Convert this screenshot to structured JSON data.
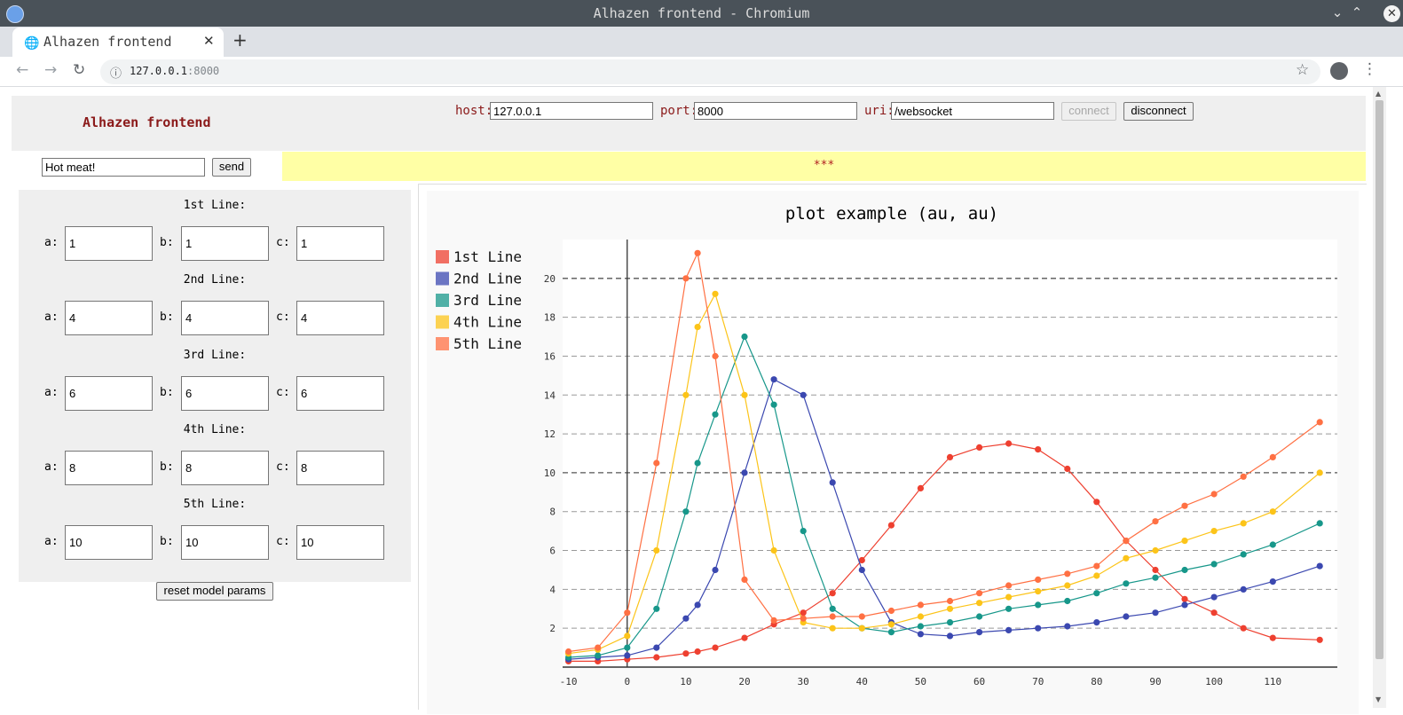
{
  "window": {
    "title": "Alhazen frontend - Chromium"
  },
  "browser": {
    "tab_title": "Alhazen frontend",
    "url_host": "127.0.0.1",
    "url_port": ":8000"
  },
  "header": {
    "brand": "Alhazen frontend",
    "host_label": "host:",
    "host_value": "127.0.0.1",
    "port_label": "port:",
    "port_value": "8000",
    "uri_label": "uri:",
    "uri_value": "/websocket",
    "connect_label": "connect",
    "disconnect_label": "disconnect"
  },
  "message": {
    "value": "Hot meat!",
    "send_label": "send"
  },
  "status": {
    "text": "***"
  },
  "params": {
    "lines": [
      {
        "heading": "1st Line:",
        "a": "1",
        "b": "1",
        "c": "1"
      },
      {
        "heading": "2nd Line:",
        "a": "4",
        "b": "4",
        "c": "4"
      },
      {
        "heading": "3rd Line:",
        "a": "6",
        "b": "6",
        "c": "6"
      },
      {
        "heading": "4th Line:",
        "a": "8",
        "b": "8",
        "c": "8"
      },
      {
        "heading": "5th Line:",
        "a": "10",
        "b": "10",
        "c": "10"
      }
    ],
    "a_label": "a:",
    "b_label": "b:",
    "c_label": "c:",
    "reset_label": "reset model params"
  },
  "chart_data": {
    "type": "line",
    "title": "plot example (au, au)",
    "xlim": [
      -11,
      121
    ],
    "ylim": [
      0,
      22
    ],
    "x_ticks": [
      "-10",
      "0",
      "10",
      "20",
      "30",
      "40",
      "50",
      "60",
      "70",
      "80",
      "90",
      "100",
      "110"
    ],
    "y_ticks": [
      "2",
      "4",
      "6",
      "8",
      "10",
      "12",
      "14",
      "16",
      "18",
      "20"
    ],
    "grid": "horizontal dashed",
    "legend_position": "top-left",
    "x": [
      -10,
      -5,
      0,
      5,
      10,
      12,
      15,
      20,
      25,
      30,
      35,
      40,
      45,
      50,
      55,
      60,
      65,
      70,
      75,
      80,
      85,
      90,
      95,
      100,
      105,
      110,
      118
    ],
    "series": [
      {
        "name": "1st Line",
        "color": "#ee4030",
        "values": [
          0.3,
          0.3,
          0.4,
          0.5,
          0.7,
          0.8,
          1.0,
          1.5,
          2.2,
          2.8,
          3.8,
          5.5,
          7.3,
          9.2,
          10.8,
          11.3,
          11.5,
          11.2,
          10.2,
          8.5,
          6.5,
          5.0,
          3.5,
          2.8,
          2.0,
          1.5,
          1.4
        ]
      },
      {
        "name": "2nd Line",
        "color": "#3b48b0",
        "values": [
          0.4,
          0.5,
          0.6,
          1.0,
          2.5,
          3.2,
          5.0,
          10.0,
          14.8,
          14.0,
          9.5,
          5.0,
          2.3,
          1.7,
          1.6,
          1.8,
          1.9,
          2.0,
          2.1,
          2.3,
          2.6,
          2.8,
          3.2,
          3.6,
          4.0,
          4.4,
          5.2
        ]
      },
      {
        "name": "3rd Line",
        "color": "#17978a",
        "values": [
          0.5,
          0.6,
          1.0,
          3.0,
          8.0,
          10.5,
          13.0,
          17.0,
          13.5,
          7.0,
          3.0,
          2.0,
          1.8,
          2.1,
          2.3,
          2.6,
          3.0,
          3.2,
          3.4,
          3.8,
          4.3,
          4.6,
          5.0,
          5.3,
          5.8,
          6.3,
          7.4
        ]
      },
      {
        "name": "4th Line",
        "color": "#fcc419",
        "values": [
          0.7,
          0.9,
          1.6,
          6.0,
          14.0,
          17.5,
          19.2,
          14.0,
          6.0,
          2.3,
          2.0,
          2.0,
          2.2,
          2.6,
          3.0,
          3.3,
          3.6,
          3.9,
          4.2,
          4.7,
          5.6,
          6.0,
          6.5,
          7.0,
          7.4,
          8.0,
          10.0
        ]
      },
      {
        "name": "5th Line",
        "color": "#ff7043",
        "values": [
          0.8,
          1.0,
          2.8,
          10.5,
          20.0,
          21.3,
          16.0,
          4.5,
          2.4,
          2.5,
          2.6,
          2.6,
          2.9,
          3.2,
          3.4,
          3.8,
          4.2,
          4.5,
          4.8,
          5.2,
          6.5,
          7.5,
          8.3,
          8.9,
          9.8,
          10.8,
          12.6
        ]
      }
    ]
  }
}
